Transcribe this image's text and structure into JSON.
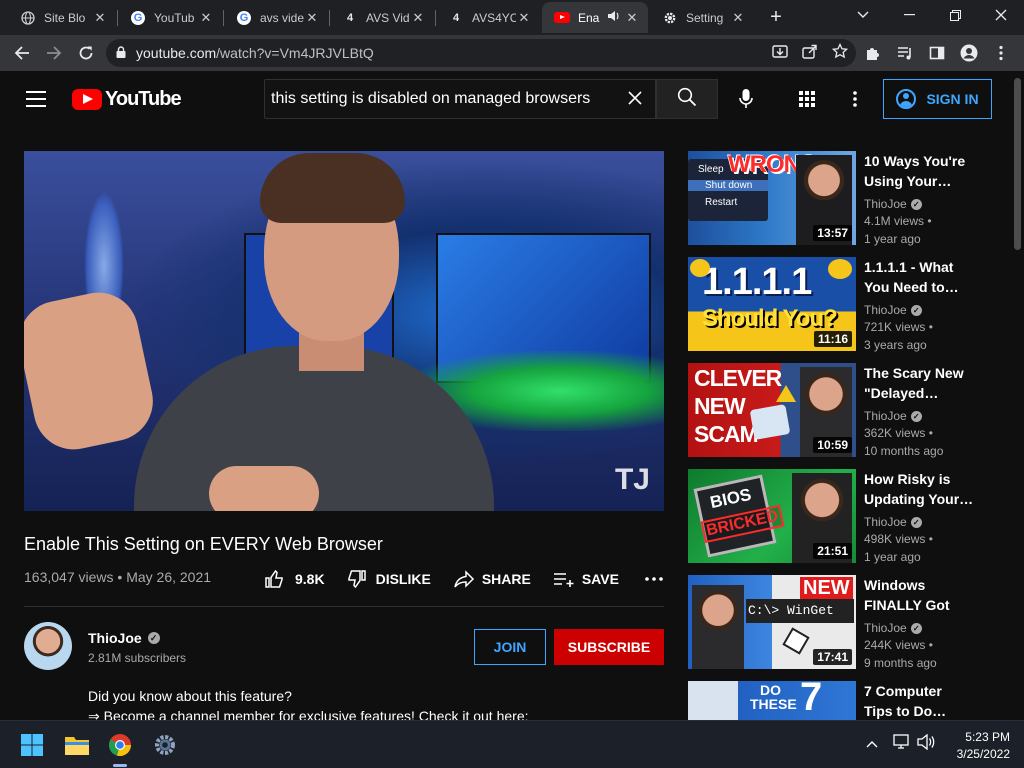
{
  "browser": {
    "tabs": [
      {
        "title": "Site Blo",
        "favicon": "globe-icon"
      },
      {
        "title": "YouTub",
        "favicon": "google-icon"
      },
      {
        "title": "avs vide",
        "favicon": "google-icon"
      },
      {
        "title": "AVS Vid",
        "favicon": "channel-4-icon",
        "fav_text": "4"
      },
      {
        "title": "AVS4YC",
        "favicon": "channel-4-icon",
        "fav_text": "4"
      },
      {
        "title": "Ena",
        "favicon": "youtube-icon",
        "active": true
      },
      {
        "title": "Setting",
        "favicon": "gear-icon"
      }
    ],
    "url_host": "youtube.com",
    "url_path": "/watch?v=Vm4JRJVLBtQ",
    "lock": "lock-icon"
  },
  "header": {
    "logo_text": "YouTube",
    "search_value": "this setting is disabled on managed browsers",
    "signin_label": "SIGN IN"
  },
  "video": {
    "title": "Enable This Setting on EVERY Web Browser",
    "views": "163,047 views",
    "date": "May 26, 2021",
    "meta_sep": " • ",
    "likes": "9.8K",
    "dislike_label": "DISLIKE",
    "share_label": "SHARE",
    "save_label": "SAVE",
    "watermark": "TJ"
  },
  "channel": {
    "name": "ThioJoe",
    "subscribers": "2.81M subscribers",
    "join_label": "JOIN",
    "subscribe_label": "SUBSCRIBE"
  },
  "description": {
    "line1": "Did you know about this feature?",
    "line2": "⇒ Become a channel member for exclusive features! Check it out here:"
  },
  "recommendations": [
    {
      "title": "10 Ways You're Using Your…",
      "channel": "ThioJoe",
      "views": "4.1M views •",
      "age": "1 year ago",
      "duration": "13:57",
      "thumb": {
        "line1": "WRONG",
        "menu1": "Sleep",
        "menu2": "Shut down",
        "menu3": "Restart"
      }
    },
    {
      "title": "1.1.1.1 - What You Need to…",
      "channel": "ThioJoe",
      "views": "721K views •",
      "age": "3 years ago",
      "duration": "11:16",
      "thumb": {
        "line1": "1.1.1.1",
        "line2": "Should You?"
      }
    },
    {
      "title": "The Scary New \"Delayed…",
      "channel": "ThioJoe",
      "views": "362K views •",
      "age": "10 months ago",
      "duration": "10:59",
      "thumb": {
        "line1": "CLEVER",
        "line2": "NEW",
        "line3": "SCAM"
      }
    },
    {
      "title": "How Risky is Updating Your…",
      "channel": "ThioJoe",
      "views": "498K views •",
      "age": "1 year ago",
      "duration": "21:51",
      "thumb": {
        "line1": "BIOS",
        "line2": "BRICKED"
      }
    },
    {
      "title": "Windows FINALLY Got a…",
      "channel": "ThioJoe",
      "views": "244K views •",
      "age": "9 months ago",
      "duration": "17:41",
      "thumb": {
        "line1": "NEW",
        "line2": "C:\\> WinGet"
      }
    },
    {
      "title": "7 Computer Tips to Do…",
      "thumb": {
        "line1": "DO",
        "line2": "THESE",
        "line3": "7"
      }
    }
  ],
  "taskbar": {
    "time": "5:23 PM",
    "date": "3/25/2022",
    "icons": [
      "windows-start-icon",
      "file-explorer-icon",
      "chrome-icon",
      "settings-gear-icon"
    ]
  },
  "colors": {
    "accent_blue": "#3ea6ff",
    "subscribe_red": "#cc0000",
    "youtube_red": "#ff0000",
    "background": "#0f0f0f"
  }
}
